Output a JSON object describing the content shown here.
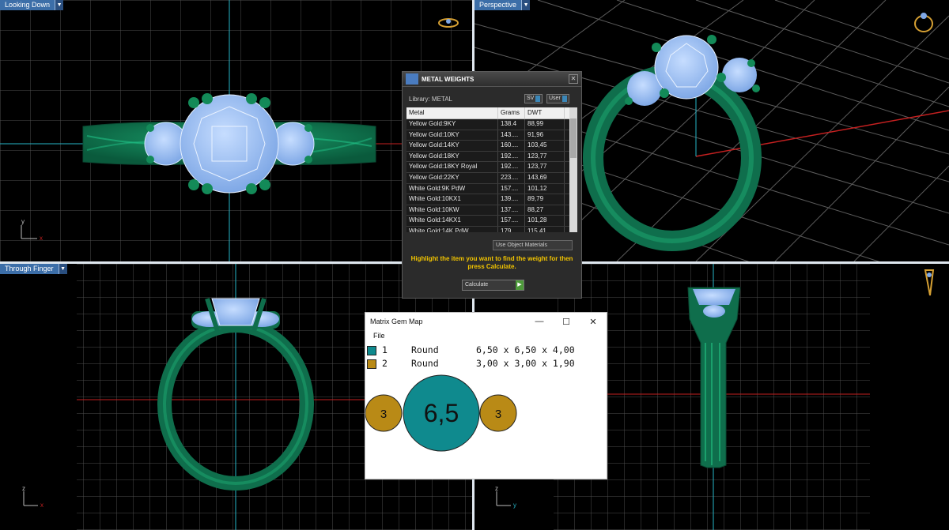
{
  "viewports": {
    "top_left": {
      "label": "Looking Down",
      "axis_a": "y",
      "axis_b": "x"
    },
    "top_right": {
      "label": "Perspective"
    },
    "bottom_left": {
      "label": "Through Finger",
      "axis_a": "z",
      "axis_b": "x"
    },
    "bottom_right": {
      "axis_a": "z",
      "axis_b": "y"
    }
  },
  "metal_weights": {
    "title": "METAL WEIGHTS",
    "library_label": "Library: METAL",
    "btn_sv": "SV",
    "btn_user": "User",
    "columns": [
      "Metal",
      "Grams",
      "DWT"
    ],
    "rows": [
      [
        "Yellow Gold:9KY",
        "138.4",
        "88,99"
      ],
      [
        "Yellow Gold:10KY",
        "143....",
        "91,96"
      ],
      [
        "Yellow Gold:14KY",
        "160....",
        "103,45"
      ],
      [
        "Yellow Gold:18KY",
        "192....",
        "123,77"
      ],
      [
        "Yellow Gold:18KY Royal",
        "192....",
        "123,77"
      ],
      [
        "Yellow Gold:22KY",
        "223....",
        "143,69"
      ],
      [
        "White Gold:9K PdW",
        "157....",
        "101,12"
      ],
      [
        "White Gold:10KX1",
        "139....",
        "89,79"
      ],
      [
        "White Gold:10KW",
        "137....",
        "88,27"
      ],
      [
        "White Gold:14KX1",
        "157....",
        "101,28"
      ],
      [
        "White Gold:14K PdW",
        "179....",
        "115,41"
      ]
    ],
    "use_object_materials": "Use Object Materials",
    "hint": "Highlight the item you want to find the weight for then press Calculate.",
    "calculate": "Calculate",
    "close": "✕"
  },
  "gem_map": {
    "title": "Matrix Gem Map",
    "menu_file": "File",
    "window_min": "—",
    "window_max": "☐",
    "window_close": "✕",
    "gems": [
      {
        "num": "1",
        "shape": "Round",
        "dims": "6,50 x 6,50 x 4,00",
        "color": "#0f8a8e"
      },
      {
        "num": "2",
        "shape": "Round",
        "dims": "3,00 x 3,00 x 1,90",
        "color": "#b98a16"
      }
    ],
    "circles": {
      "left": "3",
      "center": "6,5",
      "right": "3"
    }
  },
  "colors": {
    "metal_green": "#0f6e4c",
    "gem_blue": "#9cc4f4",
    "grid_line": "#4a4a4a",
    "axis_red": "#c42020",
    "axis_cyan": "#26b6c8"
  }
}
